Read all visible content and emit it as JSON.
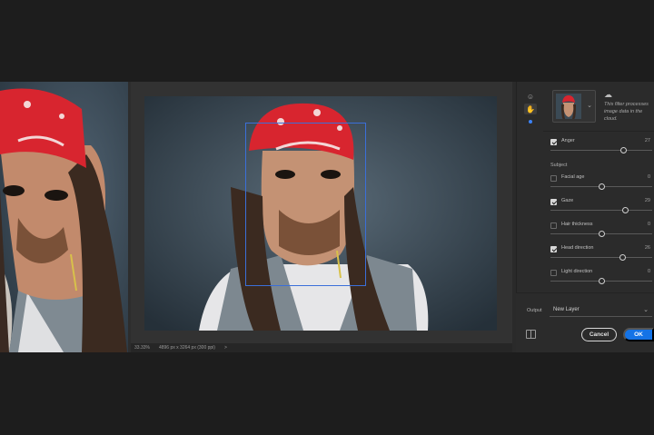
{
  "panel": {
    "cloud_note": "This filter processes image data in the cloud.",
    "anger": {
      "label": "Anger",
      "value": "27",
      "level": 0.72,
      "checked": true
    },
    "subject_label": "Subject",
    "facial_age": {
      "label": "Facial age",
      "value": "0",
      "level": 0.5,
      "checked": false
    },
    "gaze": {
      "label": "Gaze",
      "value": "29",
      "level": 0.74,
      "checked": true
    },
    "hair_thickness": {
      "label": "Hair thickness",
      "value": "0",
      "level": 0.5,
      "checked": false
    },
    "head_direction": {
      "label": "Head direction",
      "value": "26",
      "level": 0.71,
      "checked": true
    },
    "light_direction": {
      "label": "Light direction",
      "value": "0",
      "level": 0.5,
      "checked": false
    }
  },
  "output": {
    "label": "Output",
    "value": "New Layer"
  },
  "buttons": {
    "cancel": "Cancel",
    "ok": "OK"
  },
  "status": {
    "zoom": "33.33%",
    "dimensions": "4896 px x 3264 px (300 ppi)",
    "arrow": ">"
  },
  "colors": {
    "accent": "#1473e6",
    "face_box": "#3b6fd9",
    "bandana": "#d8252f"
  }
}
